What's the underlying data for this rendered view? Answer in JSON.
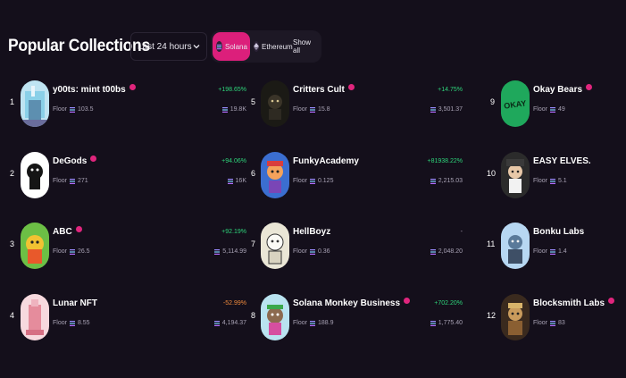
{
  "header": {
    "title": "Popular Collections",
    "time_filter": "Last 24 hours",
    "chains": [
      "Solana",
      "Ethereum",
      "Show all"
    ],
    "active_chain": "Solana"
  },
  "floor_label": "Floor",
  "colors": {
    "accent": "#dc1f7b",
    "positive": "#2ed47a",
    "negative": "#f08a3c",
    "background": "#140f1b"
  },
  "columns": [
    [
      {
        "rank": "1",
        "name": "y00ts: mint t00bs",
        "verified": true,
        "floor": "103.5",
        "change": "+198.65%",
        "volume": "19.8K"
      },
      {
        "rank": "2",
        "name": "DeGods",
        "verified": true,
        "floor": "271",
        "change": "+94.06%",
        "volume": "16K"
      },
      {
        "rank": "3",
        "name": "ABC",
        "verified": true,
        "floor": "26.5",
        "change": "+92.19%",
        "volume": "5,114.99"
      },
      {
        "rank": "4",
        "name": "Lunar NFT",
        "verified": false,
        "floor": "8.55",
        "change": "-52.99%",
        "volume": "4,194.37"
      }
    ],
    [
      {
        "rank": "5",
        "name": "Critters Cult",
        "verified": true,
        "floor": "15.8",
        "change": "+14.75%",
        "volume": "3,501.37"
      },
      {
        "rank": "6",
        "name": "FunkyAcademy",
        "verified": false,
        "floor": "0.125",
        "change": "+81938.22%",
        "volume": "2,215.03"
      },
      {
        "rank": "7",
        "name": "HellBoyz",
        "verified": false,
        "floor": "0.36",
        "change": "-",
        "volume": "2,048.20"
      },
      {
        "rank": "8",
        "name": "Solana Monkey Business",
        "verified": true,
        "floor": "188.9",
        "change": "+702.20%",
        "volume": "1,775.40"
      }
    ],
    [
      {
        "rank": "9",
        "name": "Okay Bears",
        "verified": true,
        "floor": "49",
        "avatar_text": "OKAY"
      },
      {
        "rank": "10",
        "name": "EASY ELVES.",
        "verified": false,
        "floor": "5.1"
      },
      {
        "rank": "11",
        "name": "Bonku Labs",
        "verified": false,
        "floor": "1.4"
      },
      {
        "rank": "12",
        "name": "Blocksmith Labs",
        "verified": true,
        "floor": "83"
      }
    ]
  ]
}
